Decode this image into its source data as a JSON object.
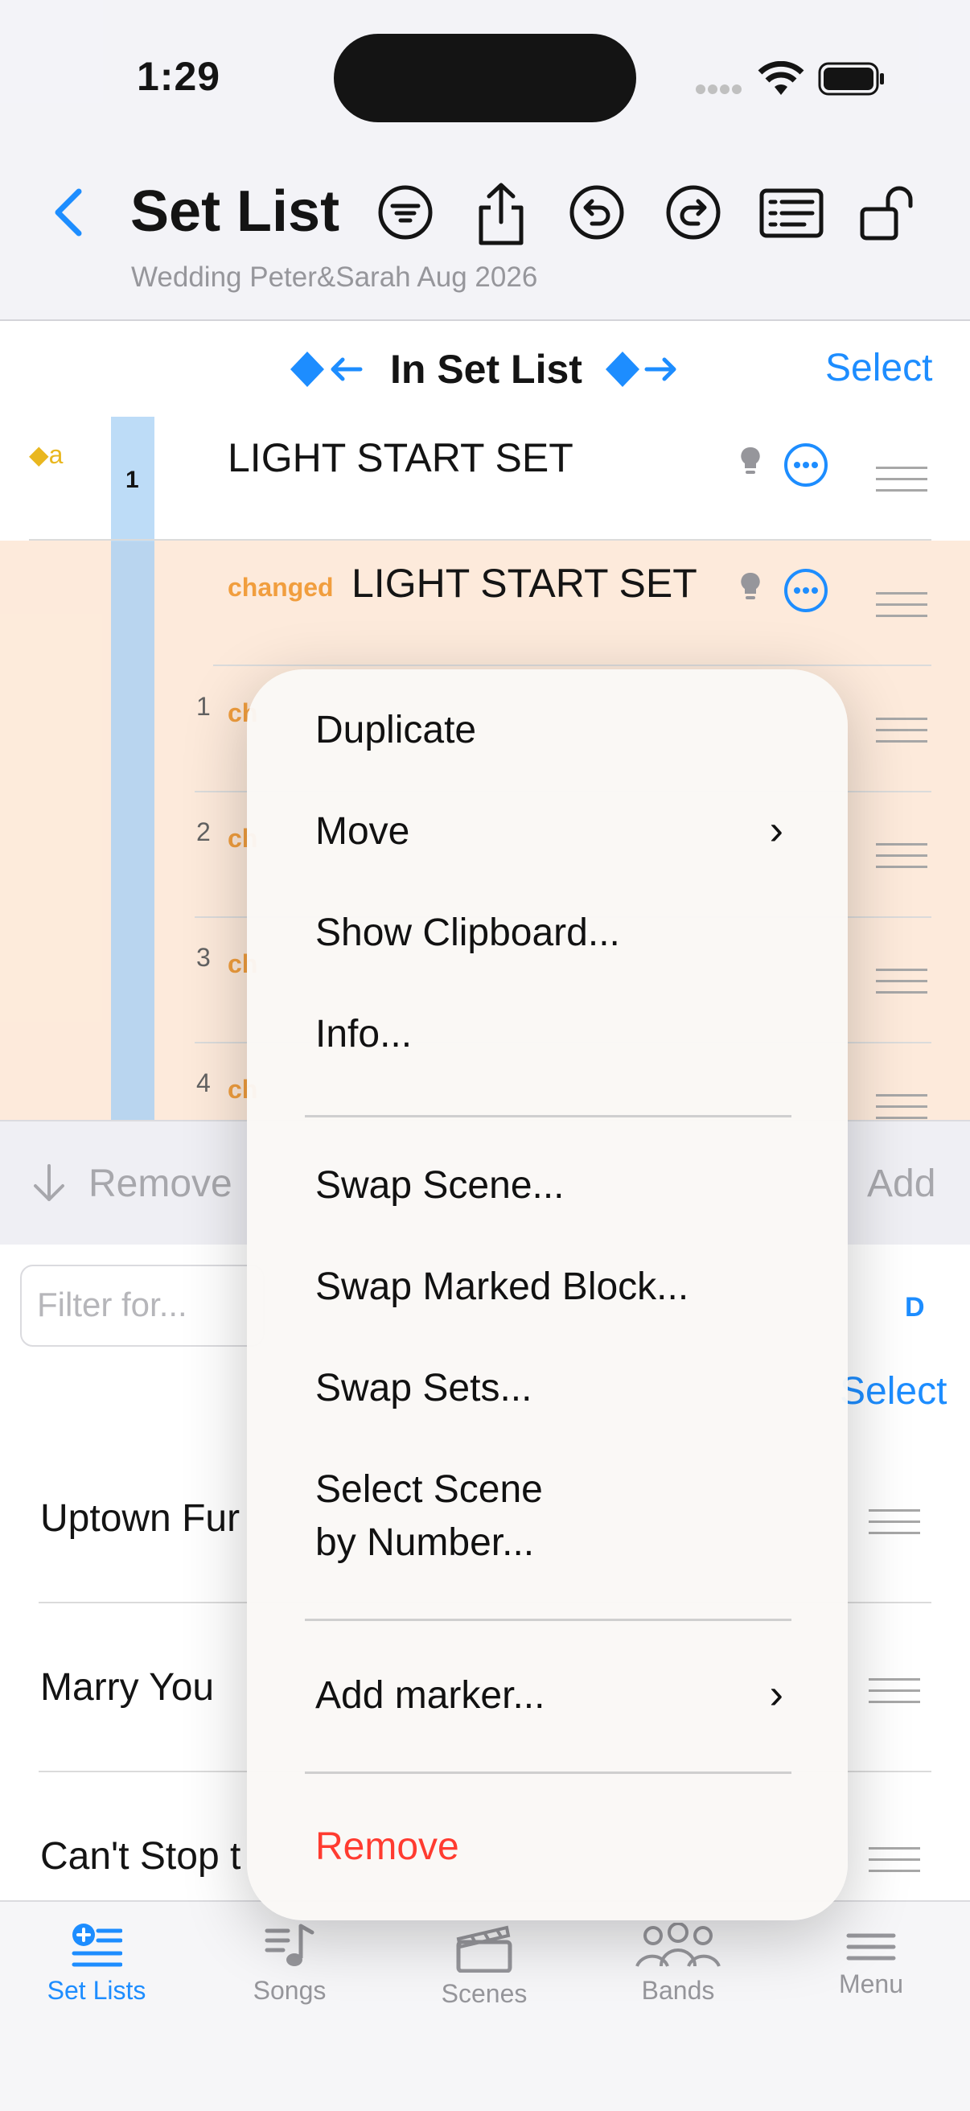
{
  "status": {
    "time": "1:29"
  },
  "nav": {
    "title": "Set List",
    "subtitle": "Wedding Peter&Sarah Aug 2026"
  },
  "header": {
    "label": "In Set List",
    "select": "Select"
  },
  "rows": {
    "marker": "◆a",
    "set_number": "1",
    "set_title": "LIGHT START SET",
    "changed_label": "changed",
    "changed_title": "LIGHT START SET",
    "numbers": [
      "1",
      "2",
      "3",
      "4"
    ]
  },
  "toolbar": {
    "remove": "Remove",
    "add": "Add"
  },
  "lower": {
    "filter_placeholder": "Filter for...",
    "d_label": "D",
    "select": "Select",
    "songs": [
      "Uptown Fur",
      "Marry You",
      "Can't Stop t"
    ]
  },
  "menu": {
    "items": [
      "Duplicate",
      "Move",
      "Show Clipboard...",
      "Info...",
      "Swap Scene...",
      "Swap Marked Block...",
      "Swap Sets...",
      "Select Scene",
      "by Number...",
      "Add marker...",
      "Remove"
    ],
    "remove_color": "#ff3b30"
  },
  "tabs": [
    "Set Lists",
    "Songs",
    "Scenes",
    "Bands",
    "Menu"
  ],
  "colors": {
    "accent": "#0a84ff",
    "orange": "#f0962e",
    "changed_bg": "#fde9d8"
  }
}
